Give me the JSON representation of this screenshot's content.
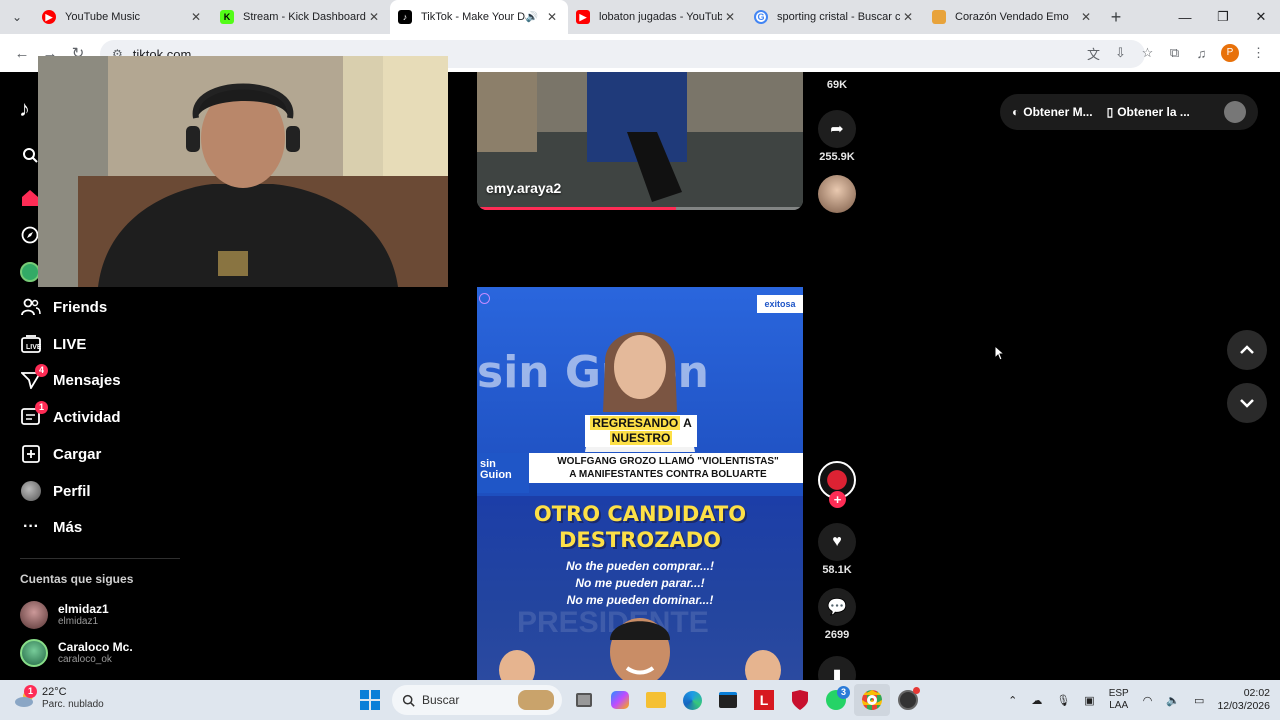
{
  "browser": {
    "tabs": [
      {
        "title": "YouTube Music",
        "favicon_color": "#ff0000",
        "active": false
      },
      {
        "title": "Stream - Kick Dashboard",
        "favicon_color": "#53fc18",
        "active": false
      },
      {
        "title": "TikTok - Make Your Da",
        "favicon_color": "#000000",
        "active": true,
        "audio": true
      },
      {
        "title": "lobaton jugadas - YouTube",
        "favicon_color": "#ff0000",
        "active": false
      },
      {
        "title": "sporting cristal - Buscar co",
        "favicon_color": "#4285f4",
        "active": false
      },
      {
        "title": "Corazón Vendado Emo",
        "favicon_color": "#e8a33b",
        "active": false
      }
    ],
    "url": "tiktok.com",
    "profile_initial": "P"
  },
  "sidebar": {
    "nav": [
      {
        "label": "Friends",
        "icon": "friends-icon"
      },
      {
        "label": "LIVE",
        "icon": "live-icon"
      },
      {
        "label": "Mensajes",
        "icon": "messages-icon",
        "badge": "4"
      },
      {
        "label": "Actividad",
        "icon": "activity-icon",
        "badge": "1"
      },
      {
        "label": "Cargar",
        "icon": "upload-icon"
      },
      {
        "label": "Perfil",
        "icon": "profile-icon"
      },
      {
        "label": "Más",
        "icon": "more-icon"
      }
    ],
    "following_title": "Cuentas que sigues",
    "following": [
      {
        "name": "elmidaz1",
        "handle": "elmidaz1"
      },
      {
        "name": "Caraloco Mc.",
        "handle": "caraloco_ok"
      }
    ]
  },
  "feed": {
    "video1": {
      "username": "emy.araya2",
      "progress": 0.61
    },
    "video1_actions": {
      "likes": "69K",
      "shares": "255.9K"
    },
    "video2": {
      "caption_top_line1": "REGRESANDO",
      "caption_top_a": "A",
      "caption_top_line2": "NUESTRO",
      "ribbon_line1": "WOLFGANG GROZO LLAMÓ \"VIOLENTISTAS\"",
      "ribbon_line2": "A MANIFESTANTES CONTRA BOLUARTE",
      "headline_line1": "OTRO CANDIDATO",
      "headline_line2": "DESTROZADO",
      "quote_line1": "No the pueden comprar...!",
      "quote_line2": "No me pueden parar...!",
      "quote_line3": "No me pueden dominar...!",
      "bg_word": "sin Guion",
      "corner_tag": "exitosa",
      "logo_text": "sin Guion",
      "watermark": "PRESIDENTE"
    },
    "video2_actions": {
      "likes": "58.1K",
      "comments": "2699"
    }
  },
  "topbar": {
    "pill1": "Obtener M...",
    "pill2": "Obtener la ..."
  },
  "taskbar": {
    "temperature": "22°C",
    "weather_desc": "Parc. nublado",
    "weather_badge": "1",
    "search_placeholder": "Buscar",
    "whatsapp_badge": "3",
    "lang1": "ESP",
    "lang2": "LAA",
    "time": "02:02",
    "date": "12/03/2026"
  },
  "colors": {
    "accent": "#fe2c55",
    "taskbar": "#dfe6ee"
  }
}
